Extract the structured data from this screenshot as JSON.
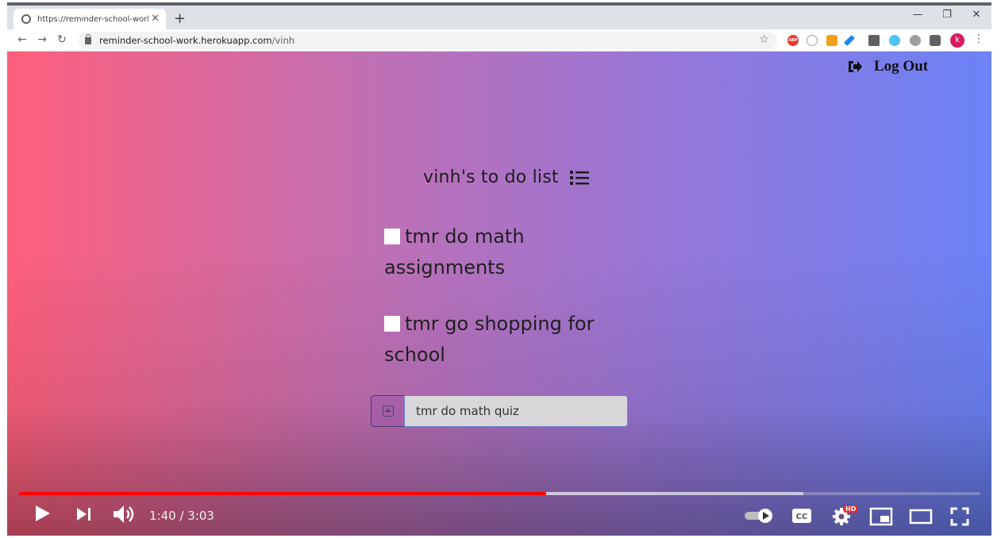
{
  "browser": {
    "tab_title": "https://reminder-school-work.he",
    "tab_close": "✕",
    "new_tab": "+",
    "minimize": "—",
    "restore": "❐",
    "close": "✕",
    "back": "←",
    "forward": "→",
    "reload": "↻",
    "url_host": "reminder-school-work.herokuapp.com",
    "url_path": "/vinh",
    "star": "☆",
    "avatar_letter": "k",
    "menu": "⋮",
    "ext_abp": "ABP"
  },
  "page": {
    "logout_label": "Log Out",
    "title": "vinh's to do list",
    "todos": [
      {
        "text": "tmr do math assignments",
        "checked": false
      },
      {
        "text": "tmr go shopping for school",
        "checked": false
      }
    ],
    "new_item_value": "tmr do math quiz"
  },
  "player": {
    "time": "1:40 / 3:03",
    "hd": "HD",
    "progress_fraction": 0.548,
    "buffer_fraction": 0.816
  },
  "colors": {
    "gradient_left": "#fe5f7c",
    "gradient_right": "#6b82f6",
    "progress": "#ff0000"
  }
}
